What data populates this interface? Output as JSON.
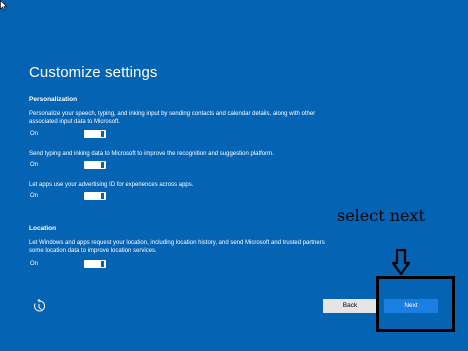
{
  "title": "Customize settings",
  "personalization": {
    "header": "Personalization",
    "items": [
      {
        "text": "Personalize your speech, typing, and inking input by sending contacts and calendar details, along with other associated input data to Microsoft.",
        "state": "On"
      },
      {
        "text": "Send typing and inking data to Microsoft to improve the recognition and suggestion platform.",
        "state": "On"
      },
      {
        "text": "Let apps use your advertising ID for experiences across apps.",
        "state": "On"
      }
    ]
  },
  "location": {
    "header": "Location",
    "items": [
      {
        "text": "Let Windows and apps request your location, including location history, and send Microsoft and trusted partners some location data to improve location services.",
        "state": "On"
      }
    ]
  },
  "footer": {
    "back_label": "Back",
    "next_label": "Next",
    "ease_of_access_icon": "ease-of-access-icon"
  },
  "annotation": {
    "text": "select next",
    "arrow_icon": "down-arrow-icon"
  },
  "colors": {
    "background": "#0563b3",
    "accent": "#1a7fe0",
    "back_button": "#e5e5e5"
  }
}
